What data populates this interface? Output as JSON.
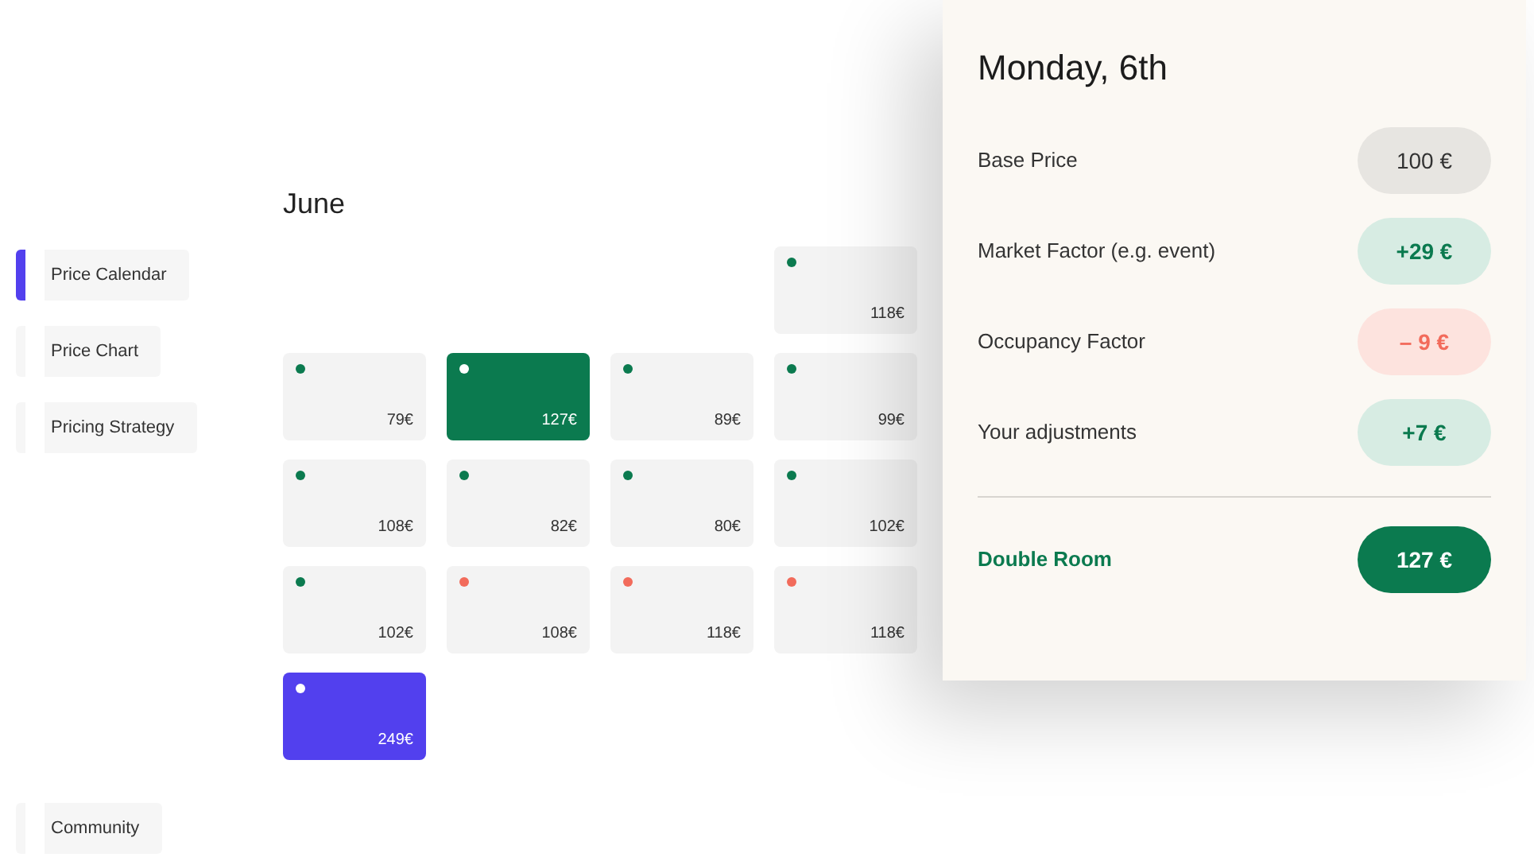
{
  "sidebar": {
    "items": [
      {
        "label": "Price Calendar",
        "selected": true
      },
      {
        "label": "Price Chart",
        "selected": false
      },
      {
        "label": "Pricing Strategy",
        "selected": false
      }
    ],
    "footer_item": {
      "label": "Community",
      "selected": false
    }
  },
  "calendar": {
    "month": "June",
    "cells": [
      {
        "kind": "empty"
      },
      {
        "kind": "empty"
      },
      {
        "kind": "empty"
      },
      {
        "kind": "day",
        "price": "118€",
        "color": "#0b7a4f"
      },
      {
        "kind": "day",
        "price": "79€",
        "color": "#0b7a4f"
      },
      {
        "kind": "selected",
        "price": "127€",
        "color": "#ffffff"
      },
      {
        "kind": "day",
        "price": "89€",
        "color": "#0b7a4f"
      },
      {
        "kind": "day",
        "price": "99€",
        "color": "#0b7a4f"
      },
      {
        "kind": "day",
        "price": "108€",
        "color": "#0b7a4f"
      },
      {
        "kind": "day",
        "price": "82€",
        "color": "#0b7a4f"
      },
      {
        "kind": "day",
        "price": "80€",
        "color": "#0b7a4f"
      },
      {
        "kind": "day",
        "price": "102€",
        "color": "#0b7a4f"
      },
      {
        "kind": "day",
        "price": "102€",
        "color": "#0b7a4f"
      },
      {
        "kind": "day",
        "price": "108€",
        "color": "#f26b5b"
      },
      {
        "kind": "day",
        "price": "118€",
        "color": "#f26b5b"
      },
      {
        "kind": "day",
        "price": "118€",
        "color": "#f26b5b"
      },
      {
        "kind": "highlight",
        "price": "249€",
        "color": "#ffffff"
      }
    ]
  },
  "details": {
    "title": "Monday, 6th",
    "rows": [
      {
        "label": "Base Price",
        "value": "100 €",
        "kind": "neutral"
      },
      {
        "label": "Market Factor (e.g. event)",
        "value": "+29 €",
        "kind": "positive"
      },
      {
        "label": "Occupancy Factor",
        "value": "– 9 €",
        "kind": "negative"
      },
      {
        "label": "Your adjustments",
        "value": "+7 €",
        "kind": "positive"
      }
    ],
    "total": {
      "label": "Double Room",
      "value": "127 €"
    }
  }
}
